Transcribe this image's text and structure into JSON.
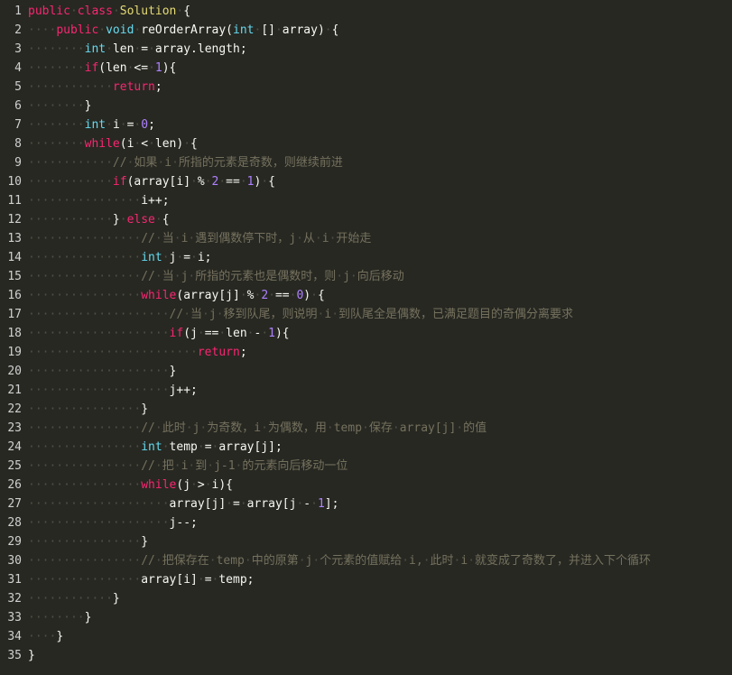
{
  "editor": {
    "lines": [
      {
        "n": "1",
        "indent": 0,
        "tokens": [
          [
            "kw",
            "public"
          ],
          [
            "sp",
            " "
          ],
          [
            "kw",
            "class"
          ],
          [
            "sp",
            " "
          ],
          [
            "cl",
            "Solution"
          ],
          [
            "sp",
            " "
          ],
          [
            "op",
            "{"
          ]
        ]
      },
      {
        "n": "2",
        "indent": 4,
        "tokens": [
          [
            "kw",
            "public"
          ],
          [
            "sp",
            " "
          ],
          [
            "ty",
            "void"
          ],
          [
            "sp",
            " "
          ],
          [
            "fn",
            "reOrderArray"
          ],
          [
            "op",
            "("
          ],
          [
            "ty",
            "int"
          ],
          [
            "sp",
            " "
          ],
          [
            "op",
            "[]"
          ],
          [
            "sp",
            " "
          ],
          [
            "fn",
            "array"
          ],
          [
            "op",
            ")"
          ],
          [
            "sp",
            " "
          ],
          [
            "op",
            "{"
          ]
        ]
      },
      {
        "n": "3",
        "indent": 8,
        "tokens": [
          [
            "ty",
            "int"
          ],
          [
            "sp",
            " "
          ],
          [
            "fn",
            "len"
          ],
          [
            "sp",
            " "
          ],
          [
            "op",
            "="
          ],
          [
            "sp",
            " "
          ],
          [
            "fn",
            "array.length;"
          ]
        ]
      },
      {
        "n": "4",
        "indent": 8,
        "tokens": [
          [
            "kw",
            "if"
          ],
          [
            "op",
            "("
          ],
          [
            "fn",
            "len"
          ],
          [
            "sp",
            " "
          ],
          [
            "op",
            "<="
          ],
          [
            "sp",
            " "
          ],
          [
            "num",
            "1"
          ],
          [
            "op",
            "){"
          ]
        ]
      },
      {
        "n": "5",
        "indent": 12,
        "tokens": [
          [
            "kw",
            "return"
          ],
          [
            "op",
            ";"
          ]
        ]
      },
      {
        "n": "6",
        "indent": 8,
        "tokens": [
          [
            "op",
            "}"
          ]
        ]
      },
      {
        "n": "7",
        "indent": 8,
        "tokens": [
          [
            "ty",
            "int"
          ],
          [
            "sp",
            " "
          ],
          [
            "fn",
            "i"
          ],
          [
            "sp",
            " "
          ],
          [
            "op",
            "="
          ],
          [
            "sp",
            " "
          ],
          [
            "num",
            "0"
          ],
          [
            "op",
            ";"
          ]
        ]
      },
      {
        "n": "8",
        "indent": 8,
        "tokens": [
          [
            "kw",
            "while"
          ],
          [
            "op",
            "("
          ],
          [
            "fn",
            "i"
          ],
          [
            "sp",
            " "
          ],
          [
            "op",
            "<"
          ],
          [
            "sp",
            " "
          ],
          [
            "fn",
            "len"
          ],
          [
            "op",
            ")"
          ],
          [
            "sp",
            " "
          ],
          [
            "op",
            "{"
          ]
        ]
      },
      {
        "n": "9",
        "indent": 12,
        "tokens": [
          [
            "cm",
            "//"
          ],
          [
            "sp",
            " "
          ],
          [
            "cmx",
            "如果"
          ],
          [
            "sp",
            " "
          ],
          [
            "cm",
            "i"
          ],
          [
            "sp",
            " "
          ],
          [
            "cmx",
            "所指的元素是奇数，则继续前进"
          ]
        ]
      },
      {
        "n": "10",
        "indent": 12,
        "tokens": [
          [
            "kw",
            "if"
          ],
          [
            "op",
            "("
          ],
          [
            "fn",
            "array[i]"
          ],
          [
            "sp",
            " "
          ],
          [
            "op",
            "%"
          ],
          [
            "sp",
            " "
          ],
          [
            "num",
            "2"
          ],
          [
            "sp",
            " "
          ],
          [
            "op",
            "=="
          ],
          [
            "sp",
            " "
          ],
          [
            "num",
            "1"
          ],
          [
            "op",
            ")"
          ],
          [
            "sp",
            " "
          ],
          [
            "op",
            "{"
          ]
        ]
      },
      {
        "n": "11",
        "indent": 16,
        "tokens": [
          [
            "fn",
            "i++;"
          ]
        ]
      },
      {
        "n": "12",
        "indent": 12,
        "tokens": [
          [
            "op",
            "}"
          ],
          [
            "sp",
            " "
          ],
          [
            "kw",
            "else"
          ],
          [
            "sp",
            " "
          ],
          [
            "op",
            "{"
          ]
        ]
      },
      {
        "n": "13",
        "indent": 16,
        "tokens": [
          [
            "cm",
            "//"
          ],
          [
            "sp",
            " "
          ],
          [
            "cmx",
            "当"
          ],
          [
            "sp",
            " "
          ],
          [
            "cm",
            "i"
          ],
          [
            "sp",
            " "
          ],
          [
            "cmx",
            "遇到偶数停下时，"
          ],
          [
            "cm",
            "j"
          ],
          [
            "sp",
            " "
          ],
          [
            "cmx",
            "从"
          ],
          [
            "sp",
            " "
          ],
          [
            "cm",
            "i"
          ],
          [
            "sp",
            " "
          ],
          [
            "cmx",
            "开始走"
          ]
        ]
      },
      {
        "n": "14",
        "indent": 16,
        "tokens": [
          [
            "ty",
            "int"
          ],
          [
            "sp",
            " "
          ],
          [
            "fn",
            "j"
          ],
          [
            "sp",
            " "
          ],
          [
            "op",
            "="
          ],
          [
            "sp",
            " "
          ],
          [
            "fn",
            "i;"
          ]
        ]
      },
      {
        "n": "15",
        "indent": 16,
        "tokens": [
          [
            "cm",
            "//"
          ],
          [
            "sp",
            " "
          ],
          [
            "cmx",
            "当"
          ],
          [
            "sp",
            " "
          ],
          [
            "cm",
            "j"
          ],
          [
            "sp",
            " "
          ],
          [
            "cmx",
            "所指的元素也是偶数时，则"
          ],
          [
            "sp",
            " "
          ],
          [
            "cm",
            "j"
          ],
          [
            "sp",
            " "
          ],
          [
            "cmx",
            "向后移动"
          ]
        ]
      },
      {
        "n": "16",
        "indent": 16,
        "tokens": [
          [
            "kw",
            "while"
          ],
          [
            "op",
            "("
          ],
          [
            "fn",
            "array[j]"
          ],
          [
            "sp",
            " "
          ],
          [
            "op",
            "%"
          ],
          [
            "sp",
            " "
          ],
          [
            "num",
            "2"
          ],
          [
            "sp",
            " "
          ],
          [
            "op",
            "=="
          ],
          [
            "sp",
            " "
          ],
          [
            "num",
            "0"
          ],
          [
            "op",
            ")"
          ],
          [
            "sp",
            " "
          ],
          [
            "op",
            "{"
          ]
        ]
      },
      {
        "n": "17",
        "indent": 20,
        "tokens": [
          [
            "cm",
            "//"
          ],
          [
            "sp",
            " "
          ],
          [
            "cmx",
            "当"
          ],
          [
            "sp",
            " "
          ],
          [
            "cm",
            "j"
          ],
          [
            "sp",
            " "
          ],
          [
            "cmx",
            "移到队尾，则说明"
          ],
          [
            "sp",
            " "
          ],
          [
            "cm",
            "i"
          ],
          [
            "sp",
            " "
          ],
          [
            "cmx",
            "到队尾全是偶数，已满足题目的奇偶分离要求"
          ]
        ]
      },
      {
        "n": "18",
        "indent": 20,
        "tokens": [
          [
            "kw",
            "if"
          ],
          [
            "op",
            "("
          ],
          [
            "fn",
            "j"
          ],
          [
            "sp",
            " "
          ],
          [
            "op",
            "=="
          ],
          [
            "sp",
            " "
          ],
          [
            "fn",
            "len"
          ],
          [
            "sp",
            " "
          ],
          [
            "op",
            "-"
          ],
          [
            "sp",
            " "
          ],
          [
            "num",
            "1"
          ],
          [
            "op",
            "){"
          ]
        ]
      },
      {
        "n": "19",
        "indent": 24,
        "tokens": [
          [
            "kw",
            "return"
          ],
          [
            "op",
            ";"
          ]
        ]
      },
      {
        "n": "20",
        "indent": 20,
        "tokens": [
          [
            "op",
            "}"
          ]
        ]
      },
      {
        "n": "21",
        "indent": 20,
        "tokens": [
          [
            "fn",
            "j++;"
          ]
        ]
      },
      {
        "n": "22",
        "indent": 16,
        "tokens": [
          [
            "op",
            "}"
          ]
        ]
      },
      {
        "n": "23",
        "indent": 16,
        "tokens": [
          [
            "cm",
            "//"
          ],
          [
            "sp",
            " "
          ],
          [
            "cmx",
            "此时"
          ],
          [
            "sp",
            " "
          ],
          [
            "cm",
            "j"
          ],
          [
            "sp",
            " "
          ],
          [
            "cmx",
            "为奇数，"
          ],
          [
            "cm",
            "i"
          ],
          [
            "sp",
            " "
          ],
          [
            "cmx",
            "为偶数，用"
          ],
          [
            "sp",
            " "
          ],
          [
            "cm",
            "temp"
          ],
          [
            "sp",
            " "
          ],
          [
            "cmx",
            "保存"
          ],
          [
            "sp",
            " "
          ],
          [
            "cm",
            "array[j]"
          ],
          [
            "sp",
            " "
          ],
          [
            "cmx",
            "的值"
          ]
        ]
      },
      {
        "n": "24",
        "indent": 16,
        "tokens": [
          [
            "ty",
            "int"
          ],
          [
            "sp",
            " "
          ],
          [
            "fn",
            "temp"
          ],
          [
            "sp",
            " "
          ],
          [
            "op",
            "="
          ],
          [
            "sp",
            " "
          ],
          [
            "fn",
            "array[j];"
          ]
        ]
      },
      {
        "n": "25",
        "indent": 16,
        "tokens": [
          [
            "cm",
            "//"
          ],
          [
            "sp",
            " "
          ],
          [
            "cmx",
            "把"
          ],
          [
            "sp",
            " "
          ],
          [
            "cm",
            "i"
          ],
          [
            "sp",
            " "
          ],
          [
            "cmx",
            "到"
          ],
          [
            "sp",
            " "
          ],
          [
            "cm",
            "j-1"
          ],
          [
            "sp",
            " "
          ],
          [
            "cmx",
            "的元素向后移动一位"
          ]
        ]
      },
      {
        "n": "26",
        "indent": 16,
        "tokens": [
          [
            "kw",
            "while"
          ],
          [
            "op",
            "("
          ],
          [
            "fn",
            "j"
          ],
          [
            "sp",
            " "
          ],
          [
            "op",
            "&gt;"
          ],
          [
            "sp",
            " "
          ],
          [
            "fn",
            "i"
          ],
          [
            "op",
            "){"
          ]
        ]
      },
      {
        "n": "27",
        "indent": 20,
        "tokens": [
          [
            "fn",
            "array[j]"
          ],
          [
            "sp",
            " "
          ],
          [
            "op",
            "="
          ],
          [
            "sp",
            " "
          ],
          [
            "fn",
            "array[j"
          ],
          [
            "sp",
            " "
          ],
          [
            "op",
            "-"
          ],
          [
            "sp",
            " "
          ],
          [
            "num",
            "1"
          ],
          [
            "fn",
            "];"
          ]
        ]
      },
      {
        "n": "28",
        "indent": 20,
        "tokens": [
          [
            "fn",
            "j--;"
          ]
        ]
      },
      {
        "n": "29",
        "indent": 16,
        "tokens": [
          [
            "op",
            "}"
          ]
        ]
      },
      {
        "n": "30",
        "indent": 16,
        "tokens": [
          [
            "cm",
            "//"
          ],
          [
            "sp",
            " "
          ],
          [
            "cmx",
            "把保存在"
          ],
          [
            "sp",
            " "
          ],
          [
            "cm",
            "temp"
          ],
          [
            "sp",
            " "
          ],
          [
            "cmx",
            "中的原第"
          ],
          [
            "sp",
            " "
          ],
          [
            "cm",
            "j"
          ],
          [
            "sp",
            " "
          ],
          [
            "cmx",
            "个元素的值赋给"
          ],
          [
            "sp",
            " "
          ],
          [
            "cm",
            "i,"
          ],
          [
            "sp",
            " "
          ],
          [
            "cmx",
            "此时"
          ],
          [
            "sp",
            " "
          ],
          [
            "cm",
            "i"
          ],
          [
            "sp",
            " "
          ],
          [
            "cmx",
            "就变成了奇数了，并进入下个循环"
          ]
        ]
      },
      {
        "n": "31",
        "indent": 16,
        "tokens": [
          [
            "fn",
            "array[i]"
          ],
          [
            "sp",
            " "
          ],
          [
            "op",
            "="
          ],
          [
            "sp",
            " "
          ],
          [
            "fn",
            "temp;"
          ]
        ]
      },
      {
        "n": "32",
        "indent": 12,
        "tokens": [
          [
            "op",
            "}"
          ]
        ]
      },
      {
        "n": "33",
        "indent": 8,
        "tokens": [
          [
            "op",
            "}"
          ]
        ]
      },
      {
        "n": "34",
        "indent": 4,
        "tokens": [
          [
            "op",
            "}"
          ]
        ]
      },
      {
        "n": "35",
        "indent": 0,
        "tokens": [
          [
            "op",
            "}"
          ]
        ]
      }
    ]
  }
}
